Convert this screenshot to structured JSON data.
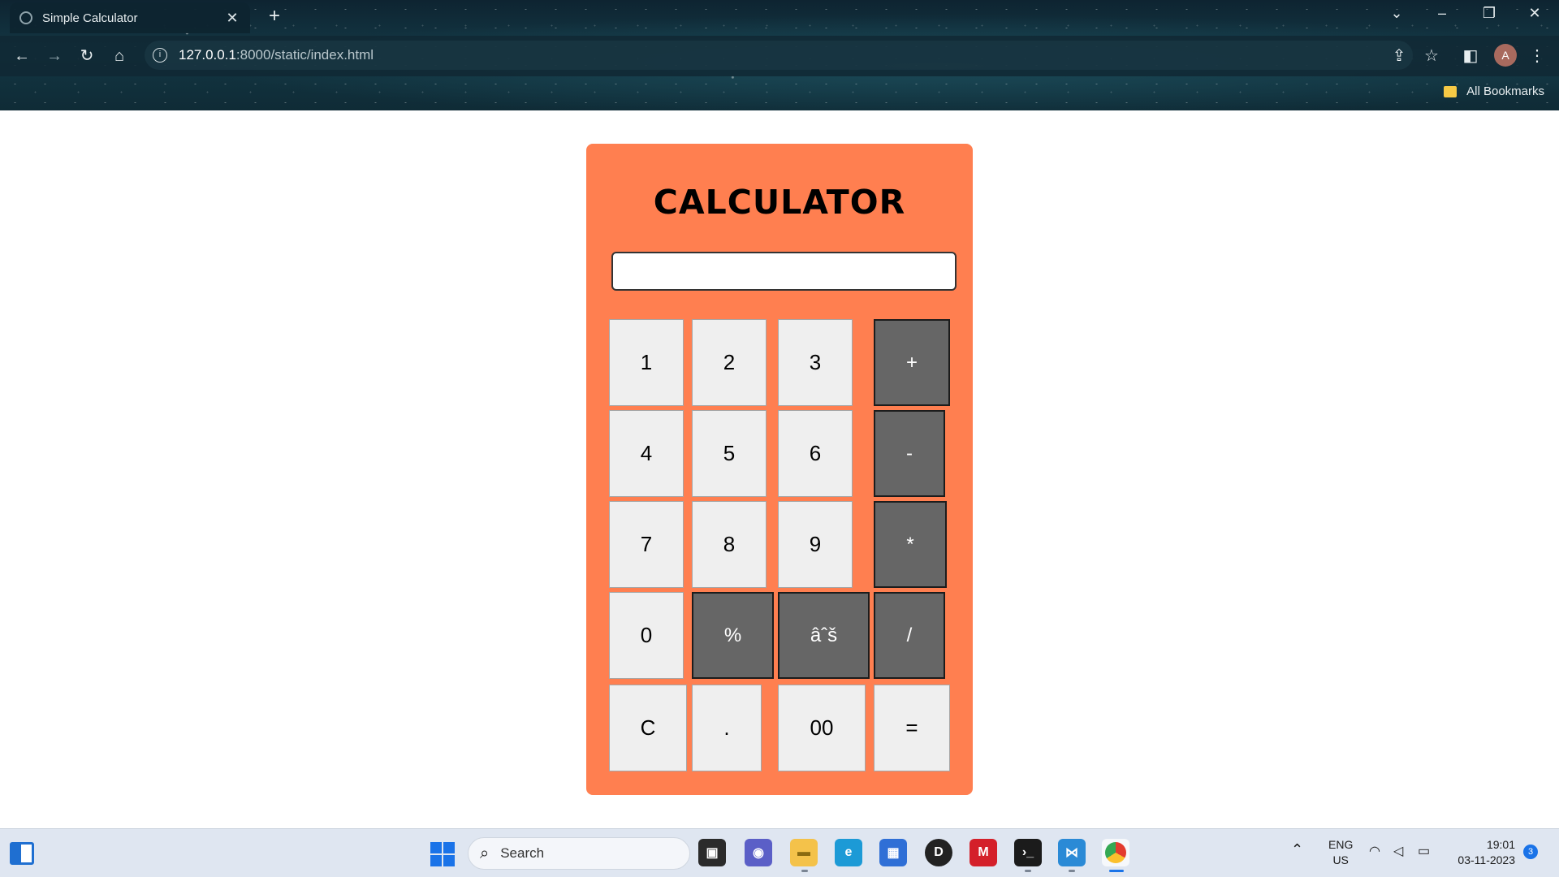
{
  "browser": {
    "tab_title": "Simple Calculator",
    "url_host": "127.0.0.1",
    "url_path": ":8000/static/index.html",
    "bookmarks_label": "All Bookmarks",
    "profile_initial": "A"
  },
  "calculator": {
    "title": "CALCULATOR",
    "display_value": "",
    "keys": [
      {
        "label": "1",
        "kind": "digit"
      },
      {
        "label": "2",
        "kind": "digit"
      },
      {
        "label": "3",
        "kind": "digit"
      },
      {
        "label": "+",
        "kind": "operator"
      },
      {
        "label": "4",
        "kind": "digit"
      },
      {
        "label": "5",
        "kind": "digit"
      },
      {
        "label": "6",
        "kind": "digit"
      },
      {
        "label": "-",
        "kind": "operator"
      },
      {
        "label": "7",
        "kind": "digit"
      },
      {
        "label": "8",
        "kind": "digit"
      },
      {
        "label": "9",
        "kind": "digit"
      },
      {
        "label": "*",
        "kind": "operator"
      },
      {
        "label": "0",
        "kind": "digit"
      },
      {
        "label": "%",
        "kind": "operator"
      },
      {
        "label": "âˆš",
        "kind": "operator"
      },
      {
        "label": "/",
        "kind": "operator"
      },
      {
        "label": "C",
        "kind": "digit"
      },
      {
        "label": ".",
        "kind": "digit"
      },
      {
        "label": "00",
        "kind": "digit"
      },
      {
        "label": "=",
        "kind": "digit"
      }
    ],
    "colors": {
      "panel": "#ff7f50",
      "key": "#efefef",
      "operator_key": "#666666"
    }
  },
  "taskbar": {
    "search_placeholder": "Search",
    "language_line1": "ENG",
    "language_line2": "US",
    "time": "19:01",
    "date": "03-11-2023",
    "notification_count": "3"
  }
}
